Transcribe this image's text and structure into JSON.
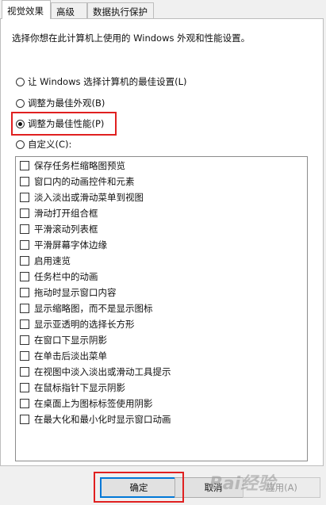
{
  "tabs": [
    {
      "label": "视觉效果"
    },
    {
      "label": "高级"
    },
    {
      "label": "数据执行保护"
    }
  ],
  "description": "选择你想在此计算机上使用的 Windows 外观和性能设置。",
  "radio_options": [
    {
      "label": "让 Windows 选择计算机的最佳设置(L)",
      "selected": false
    },
    {
      "label": "调整为最佳外观(B)",
      "selected": false
    },
    {
      "label": "调整为最佳性能(P)",
      "selected": true
    },
    {
      "label": "自定义(C):",
      "selected": false
    }
  ],
  "effects": [
    {
      "label": "保存任务栏缩略图预览",
      "checked": false
    },
    {
      "label": "窗口内的动画控件和元素",
      "checked": false
    },
    {
      "label": "淡入淡出或滑动菜单到视图",
      "checked": false
    },
    {
      "label": "滑动打开组合框",
      "checked": false
    },
    {
      "label": "平滑滚动列表框",
      "checked": false
    },
    {
      "label": "平滑屏幕字体边缘",
      "checked": false
    },
    {
      "label": "启用速览",
      "checked": false
    },
    {
      "label": "任务栏中的动画",
      "checked": false
    },
    {
      "label": "拖动时显示窗口内容",
      "checked": false
    },
    {
      "label": "显示缩略图，而不是显示图标",
      "checked": false
    },
    {
      "label": "显示亚透明的选择长方形",
      "checked": false
    },
    {
      "label": "在窗口下显示阴影",
      "checked": false
    },
    {
      "label": "在单击后淡出菜单",
      "checked": false
    },
    {
      "label": "在视图中淡入淡出或滑动工具提示",
      "checked": false
    },
    {
      "label": "在鼠标指针下显示阴影",
      "checked": false
    },
    {
      "label": "在桌面上为图标标签使用阴影",
      "checked": false
    },
    {
      "label": "在最大化和最小化时显示窗口动画",
      "checked": false
    }
  ],
  "buttons": {
    "ok": "确定",
    "cancel": "取消",
    "apply": "应用(A)"
  },
  "watermark": "Bai经验",
  "colors": {
    "highlight": "#e02020",
    "focus": "#0078d7"
  }
}
